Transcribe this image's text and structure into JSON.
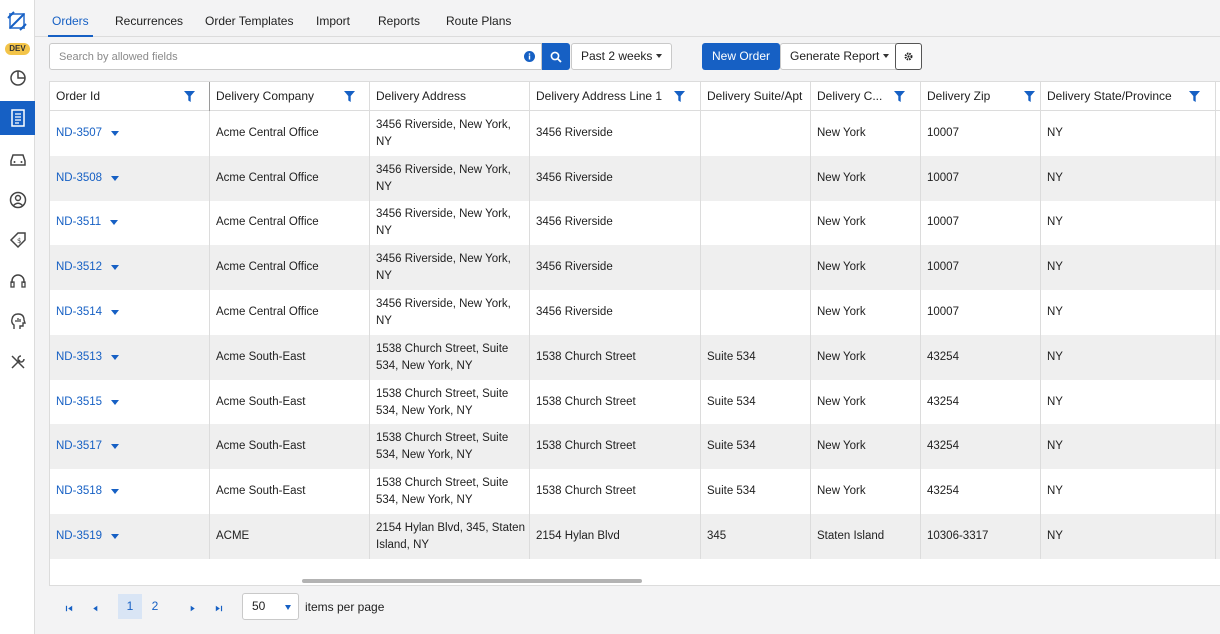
{
  "env_badge": "DEV",
  "colors": {
    "accent": "#1660c4",
    "badge": "#f3c449"
  },
  "sidebar": {
    "items": [
      {
        "icon": "pie-chart-icon"
      },
      {
        "icon": "orders-list-icon",
        "active": true
      },
      {
        "icon": "car-icon"
      },
      {
        "icon": "user-circle-icon"
      },
      {
        "icon": "price-tag-icon"
      },
      {
        "icon": "headset-icon"
      },
      {
        "icon": "analytics-head-icon"
      },
      {
        "icon": "tools-icon"
      }
    ]
  },
  "tabs": [
    "Orders",
    "Recurrences",
    "Order Templates",
    "Import",
    "Reports",
    "Route Plans"
  ],
  "toolbar": {
    "search_placeholder": "Search by allowed fields",
    "date_range": "Past 2 weeks",
    "new_order": "New Order",
    "generate_report": "Generate Report"
  },
  "table": {
    "columns": [
      "Order Id",
      "Delivery Company",
      "Delivery Address",
      "Delivery Address Line 1",
      "Delivery Suite/Apt",
      "Delivery C...",
      "Delivery Zip",
      "Delivery State/Province"
    ],
    "rows": [
      [
        "ND-3507",
        "Acme Central Office",
        "3456 Riverside, New York, NY",
        "3456 Riverside",
        "",
        "New York",
        "10007",
        "NY"
      ],
      [
        "ND-3508",
        "Acme Central Office",
        "3456 Riverside, New York, NY",
        "3456 Riverside",
        "",
        "New York",
        "10007",
        "NY"
      ],
      [
        "ND-3511",
        "Acme Central Office",
        "3456 Riverside, New York, NY",
        "3456 Riverside",
        "",
        "New York",
        "10007",
        "NY"
      ],
      [
        "ND-3512",
        "Acme Central Office",
        "3456 Riverside, New York, NY",
        "3456 Riverside",
        "",
        "New York",
        "10007",
        "NY"
      ],
      [
        "ND-3514",
        "Acme Central Office",
        "3456 Riverside, New York, NY",
        "3456 Riverside",
        "",
        "New York",
        "10007",
        "NY"
      ],
      [
        "ND-3513",
        "Acme South-East",
        "1538 Church Street, Suite 534, New York, NY",
        "1538 Church Street",
        "Suite 534",
        "New York",
        "43254",
        "NY"
      ],
      [
        "ND-3515",
        "Acme South-East",
        "1538 Church Street, Suite 534, New York, NY",
        "1538 Church Street",
        "Suite 534",
        "New York",
        "43254",
        "NY"
      ],
      [
        "ND-3517",
        "Acme South-East",
        "1538 Church Street, Suite 534, New York, NY",
        "1538 Church Street",
        "Suite 534",
        "New York",
        "43254",
        "NY"
      ],
      [
        "ND-3518",
        "Acme South-East",
        "1538 Church Street, Suite 534, New York, NY",
        "1538 Church Street",
        "Suite 534",
        "New York",
        "43254",
        "NY"
      ],
      [
        "ND-3519",
        "ACME",
        "2154 Hylan Blvd, 345, Staten Island, NY",
        "2154 Hylan Blvd",
        "345",
        "Staten Island",
        "10306-3317",
        "NY"
      ]
    ]
  },
  "pager": {
    "pages": [
      "1",
      "2"
    ],
    "page_size": "50",
    "page_size_label": "items per page"
  }
}
